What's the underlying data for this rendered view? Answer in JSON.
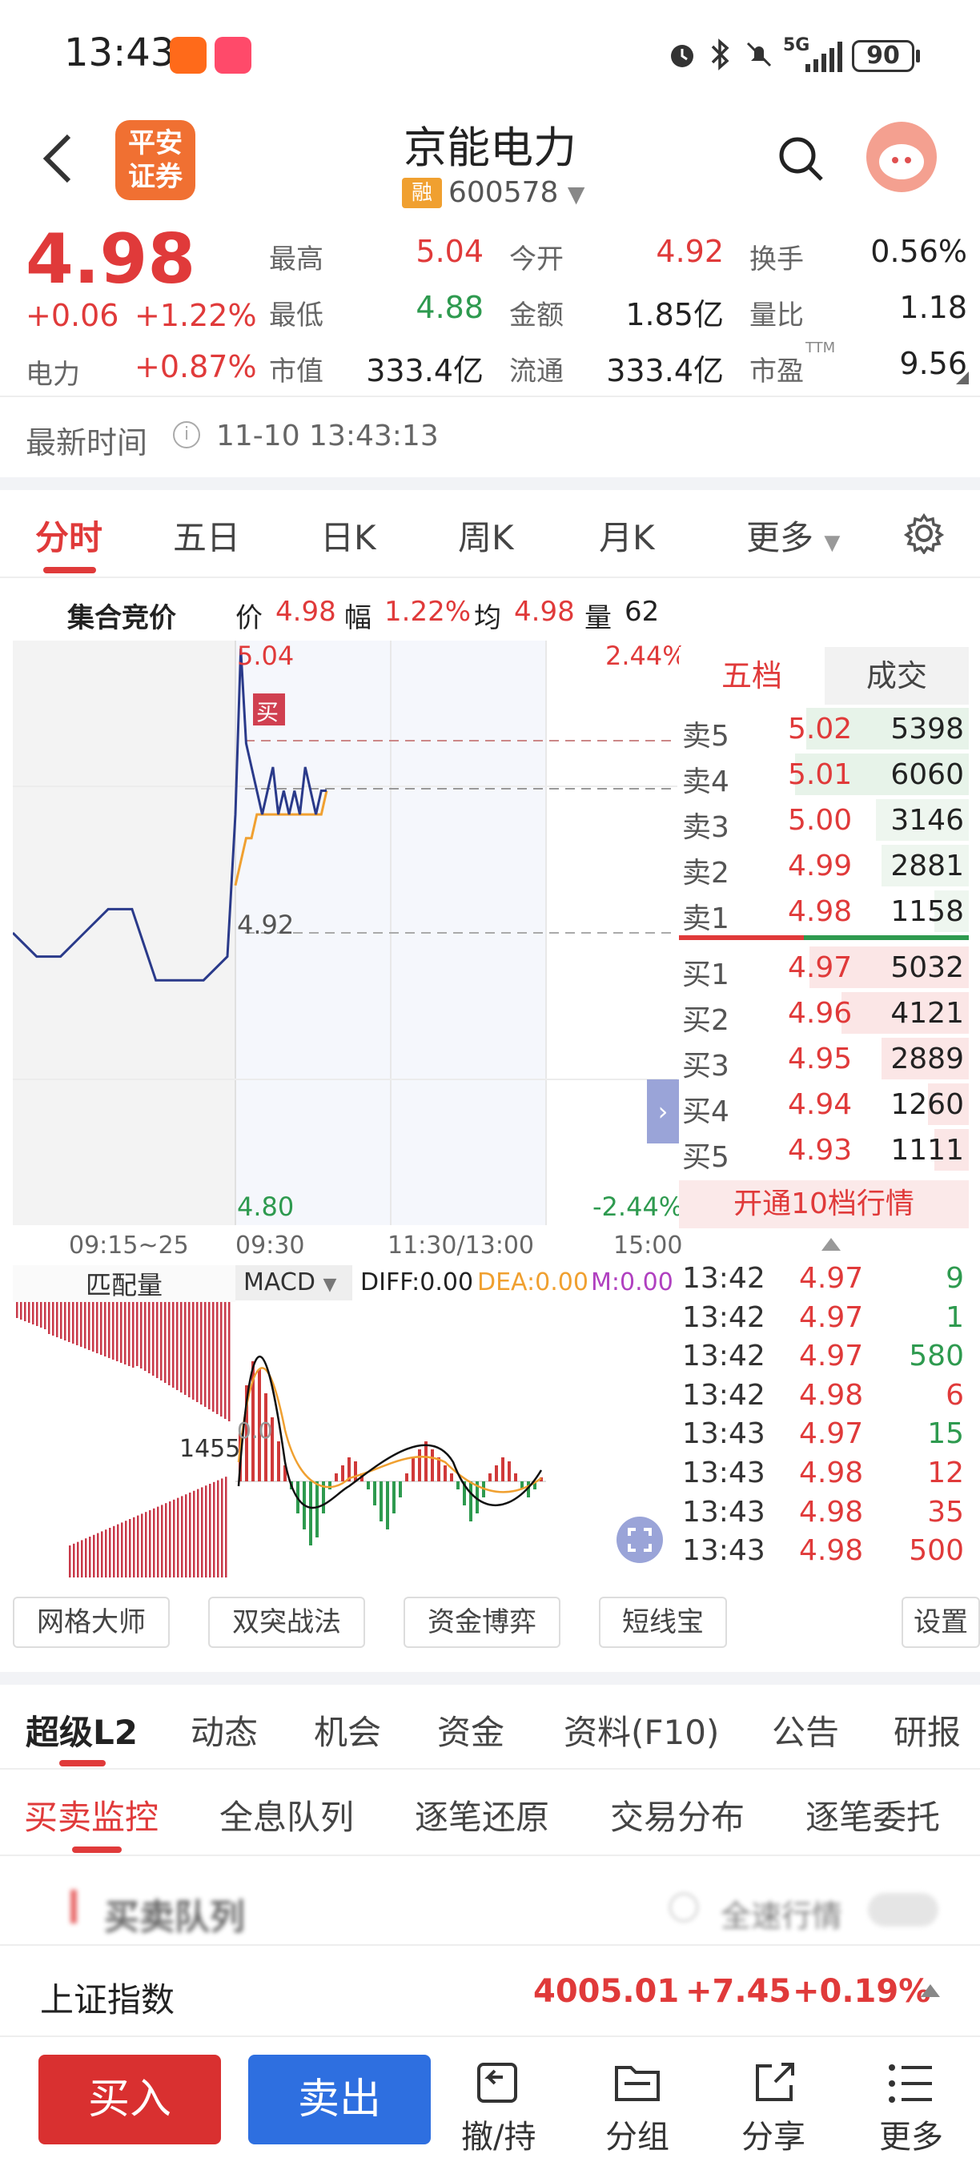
{
  "status_bar": {
    "time": "13:43",
    "signal": "5G",
    "battery": "90"
  },
  "header": {
    "logo_line1": "平安",
    "logo_line2": "证券",
    "stock_name": "京能电力",
    "margin_badge": "融",
    "stock_code": "600578"
  },
  "quote": {
    "price": "4.98",
    "change": "+0.06",
    "change_pct": "+1.22%",
    "sector_label": "电力",
    "sector_pct": "+0.87%",
    "high_label": "最高",
    "high": "5.04",
    "low_label": "最低",
    "low": "4.88",
    "mcap_label": "市值",
    "mcap": "333.4亿",
    "open_label": "今开",
    "open": "4.92",
    "amount_label": "金额",
    "amount": "1.85亿",
    "float_label": "流通",
    "float": "333.4亿",
    "turnover_label": "换手",
    "turnover": "0.56%",
    "vol_ratio_label": "量比",
    "vol_ratio": "1.18",
    "pe_label": "市盈",
    "pe_sup": "TTM",
    "pe": "9.56",
    "latest_time_label": "最新时间",
    "latest_time": "11-10 13:43:13"
  },
  "chart_tabs": [
    "分时",
    "五日",
    "日K",
    "周K",
    "月K",
    "更多"
  ],
  "chart_info": {
    "section": "集合竞价",
    "price_label": "价",
    "price": "4.98",
    "amp_label": "幅",
    "amp": "1.22%",
    "avg_label": "均",
    "avg": "4.98",
    "vol_label": "量",
    "vol": "62",
    "y_high": "5.04",
    "y_mid": "4.92",
    "y_low": "4.80",
    "pct_high": "2.44%",
    "pct_low": "-2.44%",
    "buy_marker": "买",
    "x_ticks": [
      "09:15~25",
      "09:30",
      "11:30/13:00",
      "15:00"
    ],
    "match_vol_label": "匹配量",
    "match_vol_value": "1455",
    "macd_label": "MACD",
    "diff": "DIFF:0.00",
    "dea": "DEA:0.00",
    "m": "M:0.00",
    "macd_zero": "0.0"
  },
  "chart_data": {
    "type": "line",
    "ylim": [
      4.8,
      5.04
    ],
    "series": [
      {
        "values": [
          4.92,
          4.91,
          4.91,
          4.92,
          4.93,
          4.93,
          4.9,
          4.9,
          4.9,
          4.91,
          4.97,
          5.04,
          5.0,
          4.99,
          4.98,
          4.97,
          4.98,
          4.99,
          4.97,
          4.98,
          4.97,
          4.98,
          4.97,
          4.99,
          4.98,
          4.97,
          4.98,
          4.98
        ]
      },
      {
        "values": [
          4.92,
          4.92,
          4.92,
          4.92,
          4.92,
          4.92,
          4.92,
          4.92,
          4.92,
          4.92,
          4.94,
          4.95,
          4.96,
          4.96,
          4.97,
          4.97,
          4.97,
          4.97,
          4.97,
          4.97,
          4.97,
          4.97,
          4.97,
          4.97,
          4.97,
          4.97,
          4.97,
          4.98
        ]
      }
    ]
  },
  "order_book": {
    "tab_active": "五档",
    "tab_other": "成交",
    "asks": [
      {
        "label": "卖5",
        "price": "5.02",
        "vol": "5398"
      },
      {
        "label": "卖4",
        "price": "5.01",
        "vol": "6060"
      },
      {
        "label": "卖3",
        "price": "5.00",
        "vol": "3146"
      },
      {
        "label": "卖2",
        "price": "4.99",
        "vol": "2881"
      },
      {
        "label": "卖1",
        "price": "4.98",
        "vol": "1158"
      }
    ],
    "bids": [
      {
        "label": "买1",
        "price": "4.97",
        "vol": "5032"
      },
      {
        "label": "买2",
        "price": "4.96",
        "vol": "4121"
      },
      {
        "label": "买3",
        "price": "4.95",
        "vol": "2889"
      },
      {
        "label": "买4",
        "price": "4.94",
        "vol": "1260"
      },
      {
        "label": "买5",
        "price": "4.93",
        "vol": "1111"
      }
    ],
    "upgrade": "开通10档行情"
  },
  "ticks": [
    {
      "time": "13:42",
      "price": "4.97",
      "vol": "9"
    },
    {
      "time": "13:42",
      "price": "4.97",
      "vol": "1"
    },
    {
      "time": "13:42",
      "price": "4.97",
      "vol": "580"
    },
    {
      "time": "13:42",
      "price": "4.98",
      "vol": "6"
    },
    {
      "time": "13:43",
      "price": "4.97",
      "vol": "15"
    },
    {
      "time": "13:43",
      "price": "4.98",
      "vol": "12"
    },
    {
      "time": "13:43",
      "price": "4.98",
      "vol": "35"
    },
    {
      "time": "13:43",
      "price": "4.98",
      "vol": "500"
    }
  ],
  "tools": [
    "网格大师",
    "双突战法",
    "资金博弈",
    "短线宝",
    "设置"
  ],
  "info_tabs": [
    "超级L2",
    "动态",
    "机会",
    "资金",
    "资料(F10)",
    "公告",
    "研报"
  ],
  "l2_tabs": [
    "买卖监控",
    "全息队列",
    "逐笔还原",
    "交易分布",
    "逐笔委托"
  ],
  "blurred": {
    "title": "买卖队列",
    "toggle_label": "全速行情"
  },
  "index_bar": {
    "name": "上证指数",
    "value": "4005.01",
    "change": "+7.45",
    "pct": "+0.19%"
  },
  "bottom_bar": {
    "buy": "买入",
    "sell": "卖出",
    "items": [
      "撤/持",
      "分组",
      "分享",
      "更多"
    ]
  }
}
